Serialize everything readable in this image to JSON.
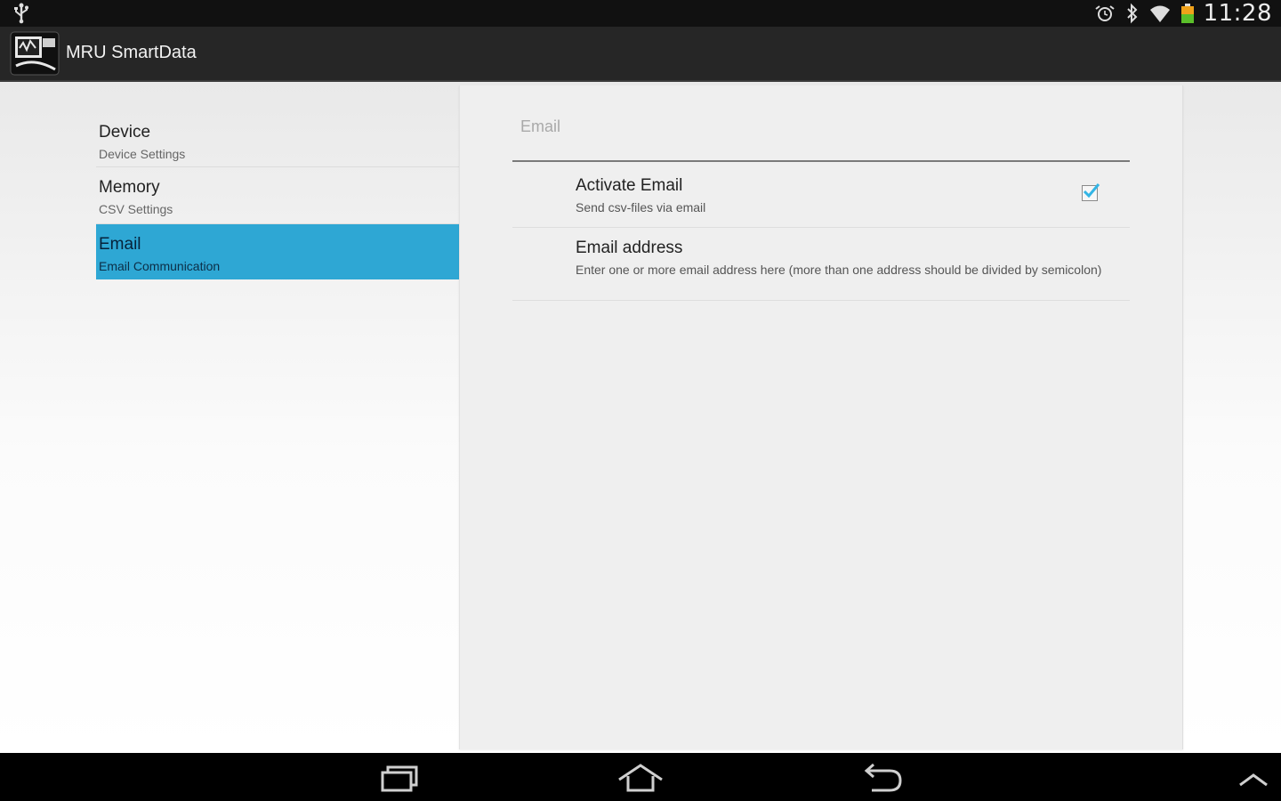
{
  "status_bar": {
    "time": "11:28",
    "icons": [
      "usb-icon",
      "alarm-icon",
      "bluetooth-icon",
      "wifi-icon",
      "battery-icon"
    ]
  },
  "action_bar": {
    "app_icon": "app-logo-icon",
    "title": "MRU SmartData"
  },
  "headers": [
    {
      "title": "Device",
      "summary": "Device Settings",
      "selected": false
    },
    {
      "title": "Memory",
      "summary": "CSV Settings",
      "selected": false
    },
    {
      "title": "Email",
      "summary": "Email Communication",
      "selected": true
    }
  ],
  "detail": {
    "category": "Email",
    "preferences": [
      {
        "title": "Activate Email",
        "summary": "Send csv-files via email",
        "checked": true
      },
      {
        "title": "Email address",
        "summary": "Enter one or more email address here (more than one address should be divided by semicolon)"
      }
    ]
  },
  "nav_bar": {
    "buttons": [
      "recent-apps-icon",
      "home-icon",
      "back-icon",
      "up-arrow-icon"
    ]
  },
  "colors": {
    "accent": "#2ea7d4",
    "checkmark": "#33b5e5"
  }
}
